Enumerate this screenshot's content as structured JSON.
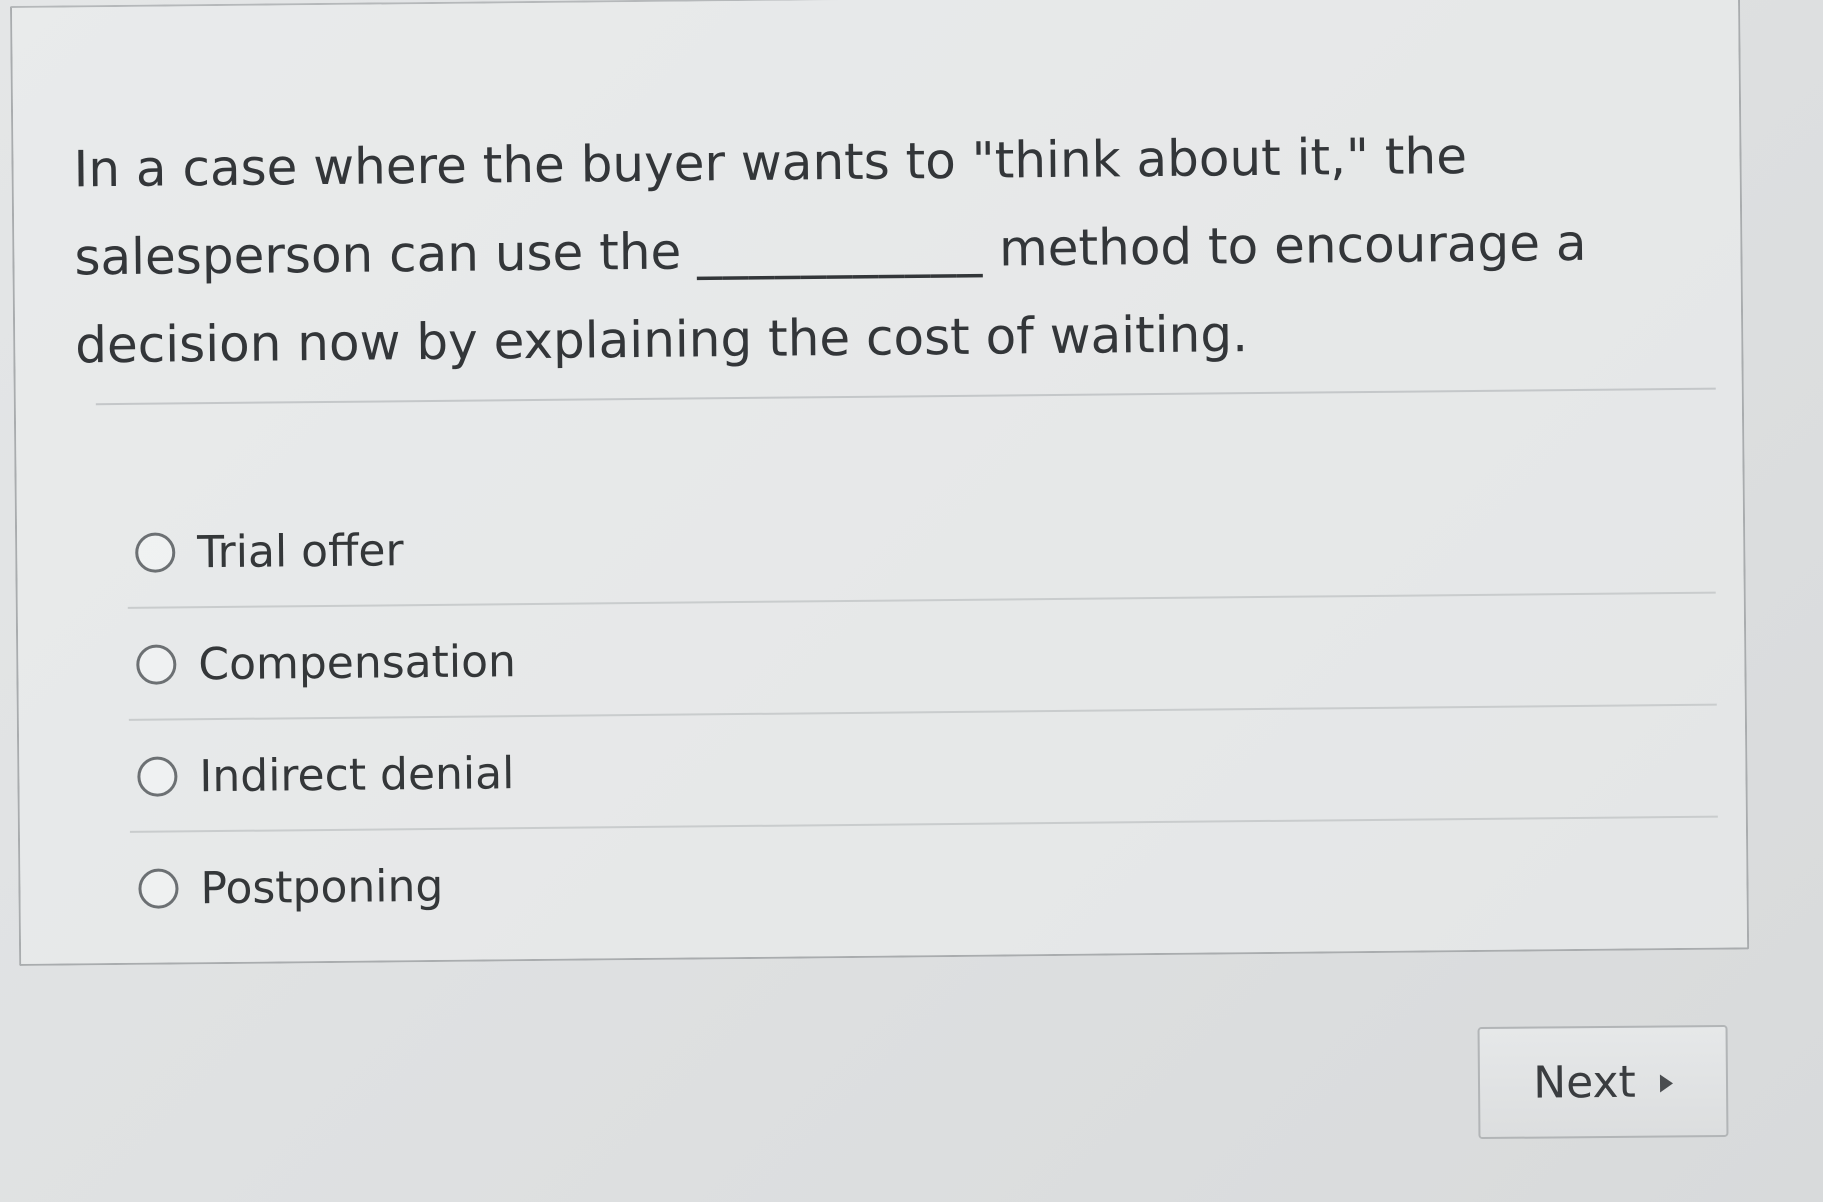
{
  "question": {
    "text_before_blank": "In a case where the buyer wants to \"think about it,\" the salesperson can use the",
    "blank": "___________",
    "text_after_blank": "method to encourage a decision now by explaining the cost of waiting."
  },
  "options": [
    {
      "label": "Trial offer",
      "selected": false
    },
    {
      "label": "Compensation",
      "selected": false
    },
    {
      "label": "Indirect denial",
      "selected": false
    },
    {
      "label": "Postponing",
      "selected": false
    }
  ],
  "navigation": {
    "next_label": "Next",
    "next_icon": "play-right-icon"
  },
  "colors": {
    "background": "#e0e2e3",
    "text": "#333639",
    "border": "#a9acae"
  }
}
